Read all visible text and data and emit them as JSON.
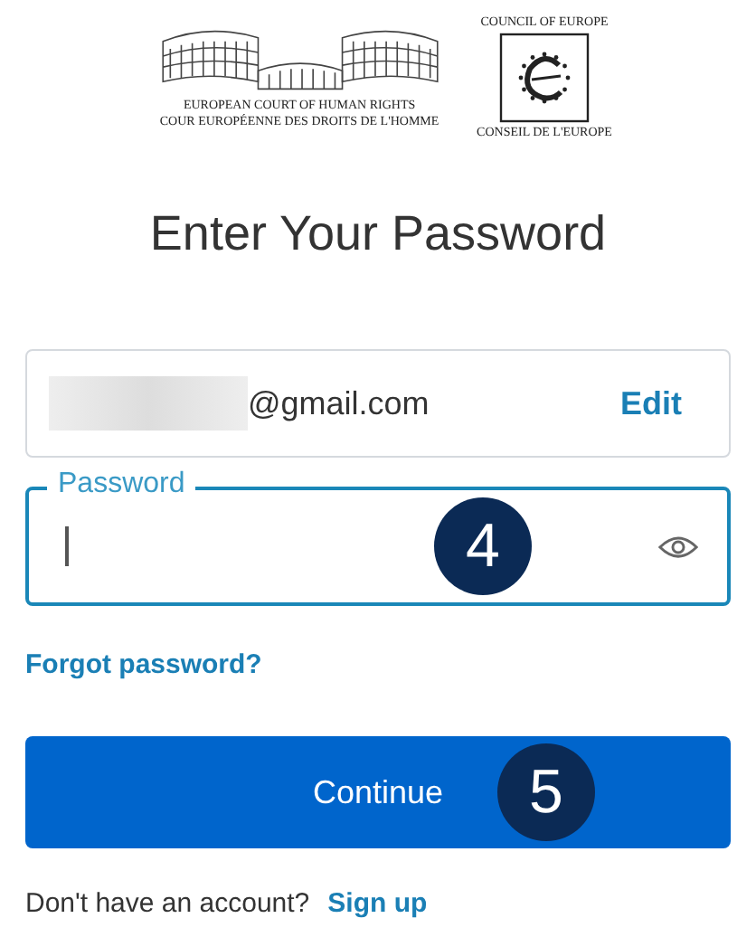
{
  "logos": {
    "court_lines": [
      "EUROPEAN COURT OF HUMAN RIGHTS",
      "COUR EUROPÉENNE DES DROITS DE L'HOMME"
    ],
    "council_top": "COUNCIL OF EUROPE",
    "council_bottom": "CONSEIL DE L'EUROPE"
  },
  "title": "Enter Your Password",
  "email": {
    "value": "@gmail.com",
    "edit": "Edit"
  },
  "password": {
    "label": "Password",
    "focused": true
  },
  "steps": [
    "4",
    "5"
  ],
  "forgot": "Forgot password?",
  "continue": "Continue",
  "footer": {
    "text": "Don't have an account?",
    "link": "Sign up"
  }
}
